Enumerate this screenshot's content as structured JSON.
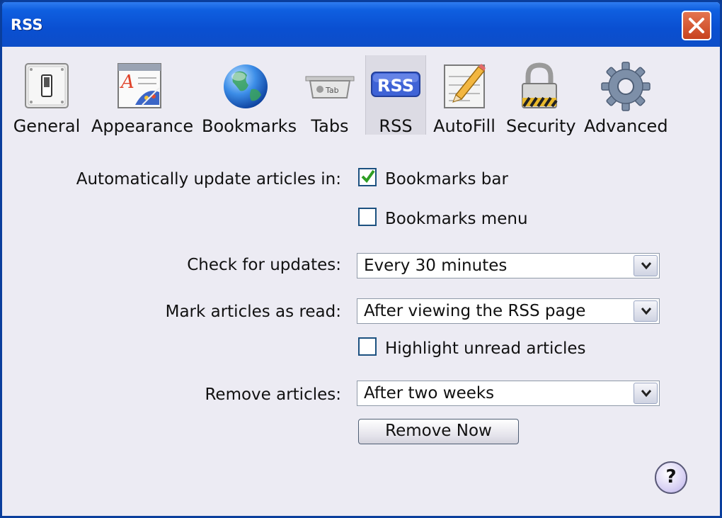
{
  "window": {
    "title": "RSS"
  },
  "toolbar": {
    "items": [
      {
        "label": "General",
        "icon": "switch-icon"
      },
      {
        "label": "Appearance",
        "icon": "font-palette-icon"
      },
      {
        "label": "Bookmarks",
        "icon": "globe-icon"
      },
      {
        "label": "Tabs",
        "icon": "tab-icon",
        "icon_text": "Tab"
      },
      {
        "label": "RSS",
        "icon": "rss-icon",
        "icon_text": "RSS",
        "selected": true
      },
      {
        "label": "AutoFill",
        "icon": "pencil-form-icon"
      },
      {
        "label": "Security",
        "icon": "padlock-icon"
      },
      {
        "label": "Advanced",
        "icon": "gear-icon"
      }
    ]
  },
  "rss": {
    "auto_update_label": "Automatically update articles in:",
    "bookmarks_bar": {
      "label": "Bookmarks bar",
      "checked": true
    },
    "bookmarks_menu": {
      "label": "Bookmarks menu",
      "checked": false
    },
    "check_updates_label": "Check for updates:",
    "check_updates_value": "Every 30 minutes",
    "mark_read_label": "Mark articles as read:",
    "mark_read_value": "After viewing the RSS page",
    "highlight_unread": {
      "label": "Highlight unread articles",
      "checked": false
    },
    "remove_label": "Remove articles:",
    "remove_value": "After two weeks",
    "remove_now_button": "Remove Now",
    "help_button": "?"
  },
  "colors": {
    "titlebar": "#0a4fd1",
    "checkmark": "#2e9d24",
    "rss_badge": "#3f63d6"
  }
}
